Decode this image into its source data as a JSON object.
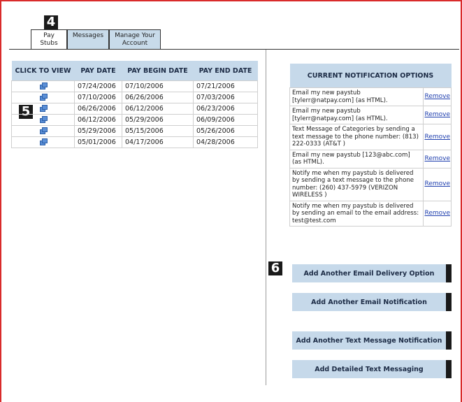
{
  "badges": {
    "tabs": "4",
    "table": "5",
    "buttons": "6"
  },
  "tabs": [
    {
      "label": "Pay Stubs",
      "active": true
    },
    {
      "label": "Messages",
      "active": false
    },
    {
      "label": "Manage Your Account",
      "active": false
    }
  ],
  "paystubs": {
    "headers": [
      "CLICK TO VIEW",
      "PAY DATE",
      "PAY BEGIN DATE",
      "PAY END DATE"
    ],
    "icon": "pay-stub-view-icon",
    "rows": [
      {
        "pay_date": "07/24/2006",
        "begin": "07/10/2006",
        "end": "07/21/2006"
      },
      {
        "pay_date": "07/10/2006",
        "begin": "06/26/2006",
        "end": "07/03/2006"
      },
      {
        "pay_date": "06/26/2006",
        "begin": "06/12/2006",
        "end": "06/23/2006"
      },
      {
        "pay_date": "06/12/2006",
        "begin": "05/29/2006",
        "end": "06/09/2006"
      },
      {
        "pay_date": "05/29/2006",
        "begin": "05/15/2006",
        "end": "05/26/2006"
      },
      {
        "pay_date": "05/01/2006",
        "begin": "04/17/2006",
        "end": "04/28/2006"
      }
    ]
  },
  "notifications": {
    "header": "CURRENT NOTIFICATION OPTIONS",
    "remove_label": "Remove",
    "items": [
      "Email my new paystub [tylerr@natpay.com] (as HTML).",
      "Email my new paystub [tylerr@natpay.com] (as HTML).",
      "Text Message of Categories by sending a text message to the phone number: (813) 222-0333 (AT&T )",
      "Email my new paystub [123@abc.com] (as HTML).",
      "Notify me when my paystub is delivered by sending a text message to the phone number: (260) 437-5979 (VERIZON WIRELESS )",
      "Notify me when my paystub is delivered by sending an email to the email address: test@test.com"
    ]
  },
  "buttons": {
    "add_email_delivery": "Add Another Email Delivery Option",
    "add_email_notification": "Add Another Email Notification",
    "add_text_notification": "Add Another Text Message Notification",
    "add_detailed_text": "Add Detailed Text Messaging"
  },
  "colors": {
    "frame": "#d92b2b",
    "header_bg": "#c6d9ea",
    "link": "#1f3fae",
    "badge": "#1a1a1a"
  }
}
